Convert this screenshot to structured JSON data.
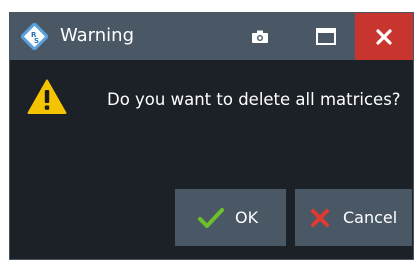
{
  "window": {
    "title": "Warning"
  },
  "titlebar": {
    "icons": [
      "rs-logo-icon",
      "camera-icon",
      "maximize-icon",
      "close-icon"
    ]
  },
  "message": {
    "icon": "warning-icon",
    "text": "Do you want to delete all matrices?"
  },
  "buttons": {
    "ok_label": "OK",
    "ok_icon": "checkmark-icon",
    "cancel_label": "Cancel",
    "cancel_icon": "cross-icon"
  },
  "colors": {
    "dialog_background": "#1c2128",
    "titlebar_background": "#4a5866",
    "close_button_background": "#c8352e",
    "button_background": "#4a5866",
    "warning_yellow": "#f5c400",
    "ok_green": "#6cc028",
    "cancel_red": "#e0392f"
  }
}
